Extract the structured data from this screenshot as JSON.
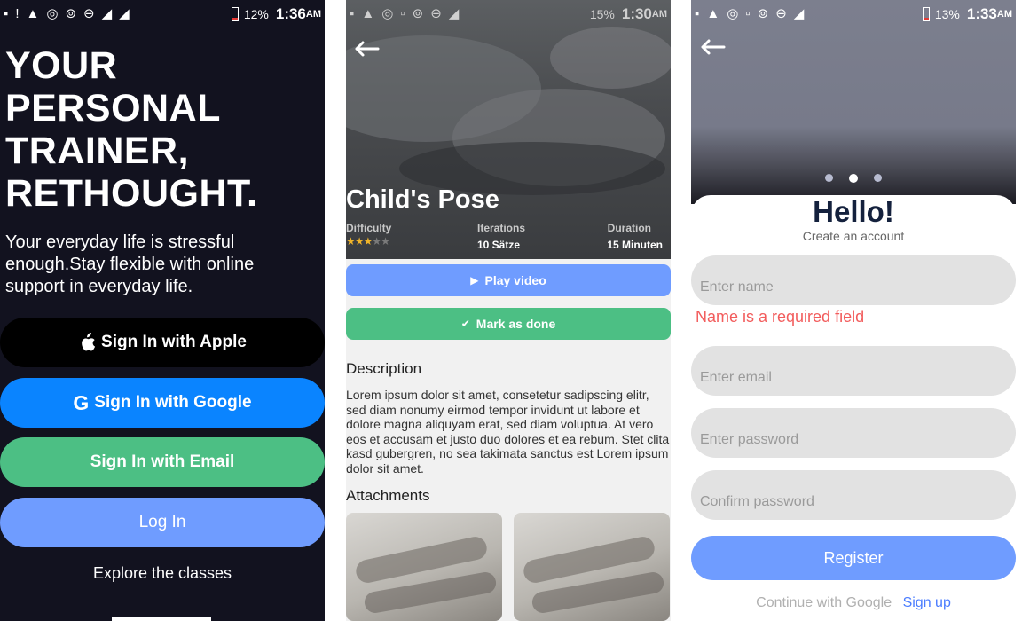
{
  "screen1": {
    "status": {
      "battery": "12%",
      "time": "1:36",
      "ampm": "AM"
    },
    "headline_lines": [
      "YOUR",
      "PERSONAL",
      "TRAINER,",
      "RETHOUGHT."
    ],
    "subcopy": "Your everyday life is stressful enough.Stay flexible with online support in everyday life.",
    "buttons": {
      "apple": "Sign In with Apple",
      "google": "Sign In with Google",
      "email": "Sign In with Email",
      "login": "Log In"
    },
    "explore": "Explore the classes"
  },
  "screen2": {
    "status": {
      "battery": "15%",
      "time": "1:30",
      "ampm": "AM"
    },
    "title": "Child's Pose",
    "stats": {
      "difficulty_label": "Difficulty",
      "difficulty_rating": 3,
      "difficulty_max": 5,
      "iterations_label": "Iterations",
      "iterations_value": "10 Sätze",
      "duration_label": "Duration",
      "duration_value": "15 Minuten"
    },
    "play_label": "Play video",
    "done_label": "Mark as done",
    "description_heading": "Description",
    "description_body": "Lorem ipsum dolor sit amet, consetetur sadipscing elitr, sed diam nonumy eirmod tempor invidunt ut labore et dolore magna aliquyam erat, sed diam voluptua. At vero eos et accusam et justo duo dolores et ea rebum. Stet clita kasd gubergren, no sea takimata sanctus est Lorem ipsum dolor sit amet.",
    "attachments_heading": "Attachments"
  },
  "screen3": {
    "status": {
      "battery": "13%",
      "time": "1:33",
      "ampm": "AM"
    },
    "carousel_active_index": 1,
    "carousel_count": 3,
    "hello": "Hello!",
    "create": "Create an account",
    "name_placeholder": "Enter name",
    "name_error": "Name is a required field",
    "email_placeholder": "Enter email",
    "password_placeholder": "Enter password",
    "confirm_placeholder": "Confirm password",
    "register_label": "Register",
    "continue_google": "Continue with Google",
    "signup_label": "Sign up"
  },
  "colors": {
    "dark_bg": "#12121f",
    "google_blue": "#0a84ff",
    "green": "#4cbf84",
    "soft_blue": "#6f9cff",
    "error_red": "#f25c5c",
    "link_blue": "#4a7cff"
  }
}
